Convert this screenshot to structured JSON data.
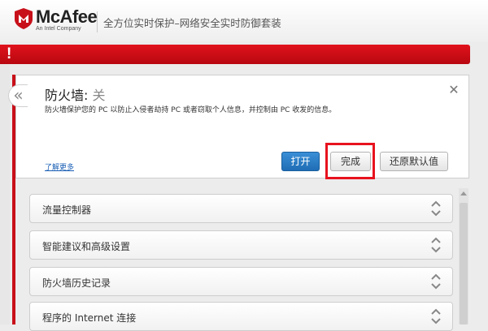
{
  "header": {
    "brand": "McAfee",
    "brand_sub": "An Intel Company",
    "tagline": "全方位实时保护–网络安全实时防御套装"
  },
  "alert": {
    "mark": "!"
  },
  "panel": {
    "collapse_glyph": "«",
    "title": "防火墙",
    "status": "关",
    "close_glyph": "✕",
    "description": "防火墙保护您的 PC 以防止入侵者劫持 PC 或者窃取个人信息，并控制由 PC 收发的信息。",
    "learn_more": "了解更多",
    "buttons": {
      "open": "打开",
      "done": "完成",
      "reset": "还原默认值"
    }
  },
  "sections": [
    {
      "label": "流量控制器"
    },
    {
      "label": "智能建议和高级设置"
    },
    {
      "label": "防火墙历史记录"
    },
    {
      "label": "程序的 Internet 连接"
    }
  ],
  "colors": {
    "brand_red": "#c8101a",
    "alert_red": "#e0121c",
    "highlight_red": "#e8121e",
    "primary_blue": "#2a7fc8",
    "link_blue": "#1a5fb4"
  }
}
